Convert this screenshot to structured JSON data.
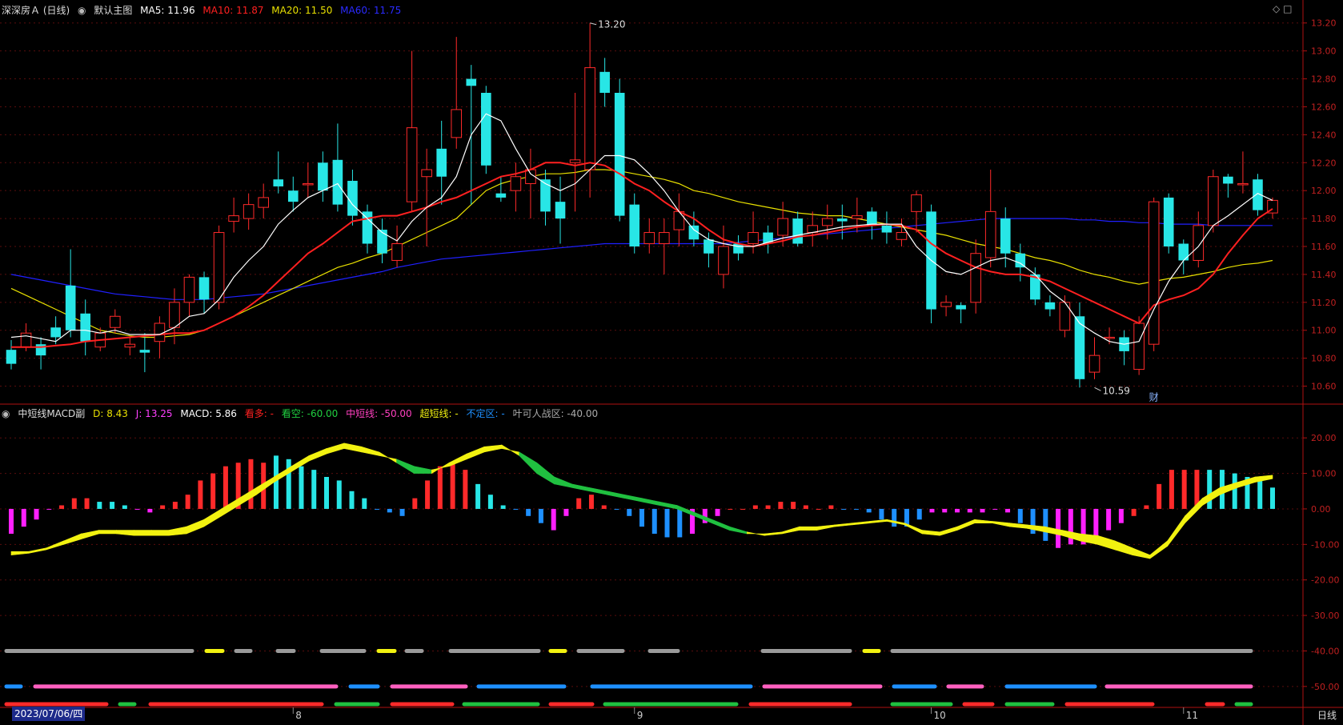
{
  "header": {
    "symbol": "深深房Ａ (日线)",
    "main_chart_label": "默认主图",
    "ma5": "MA5: 11.96",
    "ma10": "MA10: 11.87",
    "ma20": "MA20: 11.50",
    "ma60": "MA60: 11.75"
  },
  "sub_header": {
    "indicator": "中短线MACD副",
    "d": "D: 8.43",
    "j": "J: 13.25",
    "macd": "MACD: 5.86",
    "l1": "看多: -",
    "l2": "看空: -60.00",
    "l3": "中短线: -50.00",
    "l4": "超短线: -",
    "l5": "不定区: -",
    "l6": "叶可人战区: -40.00"
  },
  "colors": {
    "up": "#ff2a2a",
    "down": "#28e6e6",
    "ma5": "#ffffff",
    "ma10": "#ff2020",
    "ma20": "#e8e000",
    "ma60": "#2020ff",
    "axis": "#b01010",
    "grid": "#5a0d0d",
    "green": "#20c040",
    "yellow": "#f2f210",
    "magenta": "#ff20ff",
    "blue": "#1e90ff",
    "pink": "#ff60c0",
    "gray": "#9a9a9a"
  },
  "date_label": "2023/07/06/四",
  "period_label": "日线",
  "icons": [
    "diamond-icon",
    "window-icon"
  ],
  "chart_data": [
    {
      "type": "candlestick",
      "ylim": [
        10.5,
        13.25
      ],
      "yticks": [
        "13.20",
        "13.00",
        "12.80",
        "12.60",
        "12.40",
        "12.20",
        "12.00",
        "11.80",
        "11.60",
        "11.40",
        "11.20",
        "11.00",
        "10.80",
        "10.60"
      ],
      "month_labels": [
        {
          "label": "8",
          "index": 19
        },
        {
          "label": "9",
          "index": 42
        },
        {
          "label": "10",
          "index": 62
        },
        {
          "label": "11",
          "index": 79
        }
      ],
      "annotations": [
        {
          "text": "13.20",
          "index": 39,
          "price": 13.2
        },
        {
          "text": "10.59",
          "index": 73,
          "price": 10.59
        },
        {
          "text": "财",
          "index": 77,
          "price": 10.6
        }
      ],
      "candles": [
        [
          10.86,
          10.76,
          10.93,
          10.72
        ],
        [
          10.88,
          10.98,
          11.05,
          10.85
        ],
        [
          10.9,
          10.82,
          10.95,
          10.72
        ],
        [
          11.02,
          10.95,
          11.1,
          10.9
        ],
        [
          11.32,
          11.0,
          11.58,
          10.95
        ],
        [
          11.12,
          10.92,
          11.22,
          10.82
        ],
        [
          10.88,
          10.98,
          11.02,
          10.85
        ],
        [
          11.02,
          11.1,
          11.15,
          10.98
        ],
        [
          10.88,
          10.9,
          10.95,
          10.82
        ],
        [
          10.86,
          10.84,
          10.98,
          10.7
        ],
        [
          10.92,
          11.05,
          11.1,
          10.8
        ],
        [
          11.02,
          11.2,
          11.3,
          10.9
        ],
        [
          11.2,
          11.38,
          11.4,
          11.1
        ],
        [
          11.38,
          11.22,
          11.42,
          11.12
        ],
        [
          11.2,
          11.7,
          11.75,
          11.15
        ],
        [
          11.78,
          11.82,
          11.95,
          11.7
        ],
        [
          11.8,
          11.9,
          11.98,
          11.72
        ],
        [
          11.88,
          11.95,
          12.05,
          11.8
        ],
        [
          12.08,
          12.03,
          12.28,
          11.98
        ],
        [
          12.0,
          11.92,
          12.1,
          11.85
        ],
        [
          12.05,
          12.05,
          12.2,
          11.95
        ],
        [
          12.2,
          12.0,
          12.28,
          11.92
        ],
        [
          12.22,
          11.9,
          12.48,
          11.85
        ],
        [
          12.07,
          11.82,
          12.15,
          11.75
        ],
        [
          11.85,
          11.62,
          11.9,
          11.55
        ],
        [
          11.72,
          11.55,
          11.8,
          11.48
        ],
        [
          11.5,
          11.62,
          11.75,
          11.45
        ],
        [
          11.92,
          12.45,
          13.0,
          11.85
        ],
        [
          12.1,
          12.15,
          12.3,
          11.6
        ],
        [
          12.3,
          12.1,
          12.5,
          11.9
        ],
        [
          12.38,
          12.58,
          13.1,
          12.3
        ],
        [
          12.8,
          12.75,
          12.9,
          11.9
        ],
        [
          12.7,
          12.18,
          12.75,
          12.12
        ],
        [
          11.98,
          11.95,
          12.1,
          11.92
        ],
        [
          12.0,
          12.1,
          12.2,
          11.85
        ],
        [
          12.05,
          12.15,
          12.3,
          11.8
        ],
        [
          12.08,
          11.85,
          12.15,
          11.75
        ],
        [
          11.92,
          11.8,
          12.1,
          11.62
        ],
        [
          12.2,
          12.22,
          12.7,
          11.85
        ],
        [
          12.15,
          12.88,
          13.2,
          11.95
        ],
        [
          12.85,
          12.7,
          12.95,
          12.6
        ],
        [
          12.7,
          11.82,
          12.8,
          11.78
        ],
        [
          11.9,
          11.6,
          11.98,
          11.55
        ],
        [
          11.62,
          11.7,
          11.8,
          11.55
        ],
        [
          11.62,
          11.7,
          11.8,
          11.4
        ],
        [
          11.72,
          11.85,
          11.98,
          11.6
        ],
        [
          11.75,
          11.65,
          11.85,
          11.6
        ],
        [
          11.65,
          11.55,
          11.7,
          11.45
        ],
        [
          11.4,
          11.6,
          11.75,
          11.3
        ],
        [
          11.62,
          11.55,
          11.68,
          11.5
        ],
        [
          11.62,
          11.7,
          11.85,
          11.55
        ],
        [
          11.7,
          11.62,
          11.75,
          11.55
        ],
        [
          11.68,
          11.8,
          11.92,
          11.6
        ],
        [
          11.8,
          11.62,
          11.85,
          11.6
        ],
        [
          11.7,
          11.75,
          11.85,
          11.6
        ],
        [
          11.75,
          11.8,
          11.9,
          11.65
        ],
        [
          11.8,
          11.78,
          11.9,
          11.65
        ],
        [
          11.8,
          11.82,
          11.95,
          11.7
        ],
        [
          11.85,
          11.75,
          11.88,
          11.65
        ],
        [
          11.75,
          11.7,
          11.85,
          11.62
        ],
        [
          11.65,
          11.7,
          11.8,
          11.6
        ],
        [
          11.85,
          11.97,
          12.0,
          11.7
        ],
        [
          11.85,
          11.15,
          11.9,
          11.05
        ],
        [
          11.17,
          11.2,
          11.25,
          11.1
        ],
        [
          11.18,
          11.15,
          11.2,
          11.05
        ],
        [
          11.2,
          11.55,
          11.65,
          11.12
        ],
        [
          11.52,
          11.85,
          12.15,
          11.45
        ],
        [
          11.8,
          11.55,
          11.88,
          11.45
        ],
        [
          11.55,
          11.45,
          11.62,
          11.35
        ],
        [
          11.4,
          11.22,
          11.45,
          11.18
        ],
        [
          11.2,
          11.15,
          11.25,
          11.1
        ],
        [
          11.0,
          11.2,
          11.25,
          10.95
        ],
        [
          11.1,
          10.65,
          11.2,
          10.59
        ],
        [
          10.7,
          10.82,
          10.95,
          10.65
        ],
        [
          10.95,
          10.95,
          11.02,
          10.9
        ],
        [
          10.95,
          10.85,
          11.0,
          10.75
        ],
        [
          10.72,
          11.05,
          11.1,
          10.68
        ],
        [
          10.9,
          11.92,
          11.95,
          10.85
        ],
        [
          11.95,
          11.6,
          11.98,
          11.55
        ],
        [
          11.62,
          11.5,
          11.65,
          11.4
        ],
        [
          11.5,
          11.75,
          11.85,
          11.45
        ],
        [
          11.75,
          12.1,
          12.15,
          11.7
        ],
        [
          12.1,
          12.05,
          12.12,
          11.95
        ],
        [
          12.05,
          12.05,
          12.28,
          11.98
        ],
        [
          12.08,
          11.86,
          12.12,
          11.82
        ],
        [
          11.84,
          11.93,
          11.95,
          11.8
        ]
      ],
      "ma5": [
        10.95,
        10.96,
        10.94,
        10.92,
        11.0,
        11.0,
        10.98,
        11.0,
        10.97,
        10.97,
        10.97,
        11.02,
        11.1,
        11.12,
        11.22,
        11.38,
        11.5,
        11.6,
        11.76,
        11.86,
        11.95,
        12.0,
        12.05,
        11.9,
        11.8,
        11.7,
        11.64,
        11.78,
        11.88,
        11.95,
        12.1,
        12.4,
        12.55,
        12.5,
        12.3,
        12.12,
        12.05,
        12.0,
        12.05,
        12.15,
        12.25,
        12.25,
        12.22,
        12.12,
        12.0,
        11.85,
        11.72,
        11.65,
        11.62,
        11.6,
        11.6,
        11.63,
        11.66,
        11.68,
        11.7,
        11.72,
        11.74,
        11.75,
        11.76,
        11.76,
        11.76,
        11.6,
        11.5,
        11.42,
        11.4,
        11.45,
        11.5,
        11.52,
        11.48,
        11.4,
        11.28,
        11.2,
        11.05,
        10.98,
        10.92,
        10.9,
        10.92,
        11.15,
        11.35,
        11.5,
        11.6,
        11.75,
        11.82,
        11.9,
        11.98,
        11.93
      ],
      "ma10": [
        10.88,
        10.88,
        10.88,
        10.89,
        10.9,
        10.92,
        10.93,
        10.94,
        10.95,
        10.96,
        10.97,
        10.98,
        10.98,
        11.0,
        11.05,
        11.1,
        11.17,
        11.25,
        11.35,
        11.45,
        11.55,
        11.62,
        11.7,
        11.78,
        11.8,
        11.82,
        11.82,
        11.85,
        11.88,
        11.92,
        11.95,
        12.0,
        12.05,
        12.1,
        12.12,
        12.15,
        12.2,
        12.2,
        12.18,
        12.2,
        12.18,
        12.12,
        12.05,
        12.0,
        11.92,
        11.85,
        11.8,
        11.72,
        11.65,
        11.62,
        11.6,
        11.62,
        11.64,
        11.67,
        11.68,
        11.7,
        11.72,
        11.74,
        11.75,
        11.76,
        11.75,
        11.72,
        11.62,
        11.55,
        11.5,
        11.45,
        11.42,
        11.4,
        11.4,
        11.38,
        11.35,
        11.3,
        11.25,
        11.2,
        11.15,
        11.1,
        11.05,
        11.18,
        11.22,
        11.25,
        11.3,
        11.4,
        11.55,
        11.68,
        11.8,
        11.87
      ],
      "ma20": [
        11.3,
        11.25,
        11.2,
        11.15,
        11.1,
        11.05,
        11.0,
        10.98,
        10.96,
        10.95,
        10.95,
        10.96,
        10.97,
        11.0,
        11.05,
        11.1,
        11.15,
        11.2,
        11.25,
        11.3,
        11.35,
        11.4,
        11.45,
        11.48,
        11.52,
        11.55,
        11.6,
        11.65,
        11.7,
        11.75,
        11.8,
        11.9,
        12.0,
        12.05,
        12.08,
        12.1,
        12.12,
        12.12,
        12.13,
        12.15,
        12.15,
        12.14,
        12.12,
        12.1,
        12.08,
        12.05,
        12.0,
        11.98,
        11.95,
        11.92,
        11.9,
        11.88,
        11.86,
        11.84,
        11.83,
        11.82,
        11.82,
        11.8,
        11.78,
        11.76,
        11.74,
        11.72,
        11.7,
        11.68,
        11.65,
        11.62,
        11.6,
        11.58,
        11.55,
        11.52,
        11.5,
        11.47,
        11.43,
        11.4,
        11.38,
        11.35,
        11.33,
        11.35,
        11.37,
        11.38,
        11.4,
        11.42,
        11.45,
        11.47,
        11.48,
        11.5
      ],
      "ma60": [
        11.4,
        11.38,
        11.36,
        11.34,
        11.32,
        11.3,
        11.28,
        11.26,
        11.25,
        11.24,
        11.23,
        11.22,
        11.22,
        11.22,
        11.23,
        11.24,
        11.25,
        11.26,
        11.28,
        11.3,
        11.32,
        11.34,
        11.36,
        11.38,
        11.4,
        11.42,
        11.45,
        11.47,
        11.49,
        11.51,
        11.52,
        11.53,
        11.54,
        11.55,
        11.56,
        11.57,
        11.58,
        11.59,
        11.6,
        11.61,
        11.62,
        11.62,
        11.62,
        11.62,
        11.62,
        11.62,
        11.62,
        11.62,
        11.62,
        11.63,
        11.64,
        11.65,
        11.66,
        11.67,
        11.68,
        11.69,
        11.7,
        11.71,
        11.72,
        11.73,
        11.74,
        11.75,
        11.76,
        11.77,
        11.78,
        11.79,
        11.8,
        11.8,
        11.8,
        11.8,
        11.8,
        11.8,
        11.79,
        11.79,
        11.78,
        11.78,
        11.77,
        11.77,
        11.76,
        11.76,
        11.76,
        11.75,
        11.75,
        11.75,
        11.75,
        11.75
      ]
    },
    {
      "type": "macd_indicator",
      "ylim": [
        -55,
        25
      ],
      "yticks": [
        "20.00",
        "10.00",
        "0.00",
        "-10.00",
        "-20.00",
        "-30.00",
        "-40.00",
        "-50.00"
      ],
      "bars": [
        -7,
        -5,
        -3,
        0,
        1,
        3,
        3,
        2,
        2,
        1,
        0,
        -1,
        1,
        2,
        4,
        8,
        10,
        12,
        13,
        14,
        13,
        15,
        14,
        12,
        11,
        9,
        8,
        5,
        3,
        0,
        -1,
        -2,
        3,
        8,
        12,
        13,
        11,
        7,
        4,
        1,
        0,
        -2,
        -4,
        -6,
        -2,
        3,
        4,
        1,
        0,
        -2,
        -5,
        -7,
        -8,
        -8,
        -7,
        -4,
        -2,
        0,
        0,
        1,
        1,
        2,
        2,
        1,
        0,
        1,
        0,
        0,
        -1,
        -3,
        -5,
        -5,
        -3,
        -1,
        -1,
        -1,
        -1,
        -1,
        0,
        -1,
        -4,
        -7,
        -9,
        -11,
        -10,
        -10,
        -8,
        -6,
        -4,
        -2,
        1,
        7,
        11,
        11,
        11,
        11,
        11,
        10,
        9,
        8,
        6
      ],
      "bar_colors": [
        "m",
        "m",
        "m",
        "m",
        "r",
        "r",
        "r",
        "c",
        "c",
        "c",
        "m",
        "m",
        "r",
        "r",
        "r",
        "r",
        "r",
        "r",
        "r",
        "r",
        "r",
        "c",
        "c",
        "c",
        "c",
        "c",
        "c",
        "c",
        "c",
        "b",
        "b",
        "b",
        "r",
        "r",
        "r",
        "r",
        "r",
        "c",
        "c",
        "c",
        "b",
        "b",
        "b",
        "m",
        "m",
        "r",
        "r",
        "r",
        "b",
        "b",
        "b",
        "b",
        "b",
        "b",
        "m",
        "m",
        "m",
        "r",
        "r",
        "r",
        "r",
        "r",
        "r",
        "r",
        "r",
        "r",
        "b",
        "b",
        "b",
        "b",
        "b",
        "b",
        "b",
        "m",
        "m",
        "m",
        "m",
        "m",
        "m",
        "m",
        "b",
        "b",
        "b",
        "m",
        "m",
        "m",
        "m",
        "m",
        "m",
        "r",
        "r",
        "r",
        "r",
        "r",
        "r",
        "c",
        "c",
        "c",
        "c",
        "c",
        "c"
      ],
      "fast": [
        -12,
        -12,
        -11,
        -9,
        -7,
        -6,
        -6,
        -6,
        -6,
        -6,
        -5,
        -3,
        0,
        3,
        6,
        9,
        12,
        15,
        17,
        18.5,
        17.5,
        16,
        13,
        10,
        10,
        13,
        15.5,
        17.5,
        18,
        15,
        10,
        7,
        6,
        5,
        4,
        3,
        2,
        1,
        0,
        -2,
        -4,
        -6,
        -7,
        -7,
        -6.5,
        -5,
        -5,
        -4.5,
        -4,
        -3.5,
        -3,
        -4,
        -6,
        -6.5,
        -5,
        -3,
        -3.5,
        -4,
        -4.5,
        -5,
        -6,
        -7,
        -7.5,
        -9,
        -11,
        -13,
        -9,
        -2,
        3,
        6,
        7.5,
        9,
        9.5
      ],
      "slow": [
        -13,
        -12.5,
        -11.5,
        -10,
        -8.5,
        -7,
        -7,
        -7.5,
        -7.5,
        -7.5,
        -7,
        -5,
        -2,
        1,
        4,
        7.5,
        10.5,
        13.5,
        15.5,
        17,
        16,
        15,
        14,
        12,
        11,
        12,
        14,
        16,
        17,
        16,
        13,
        9,
        7,
        6,
        5,
        4,
        3,
        2,
        1,
        -1,
        -3,
        -5,
        -6.5,
        -7.5,
        -7,
        -6,
        -6,
        -5,
        -4.5,
        -4,
        -3.5,
        -4.5,
        -7,
        -7.5,
        -6,
        -4,
        -4,
        -5,
        -5.5,
        -6.5,
        -7.5,
        -9,
        -10,
        -11.5,
        -13,
        -14,
        -10.5,
        -4,
        1,
        4,
        6,
        7.5,
        8.5
      ]
    }
  ]
}
